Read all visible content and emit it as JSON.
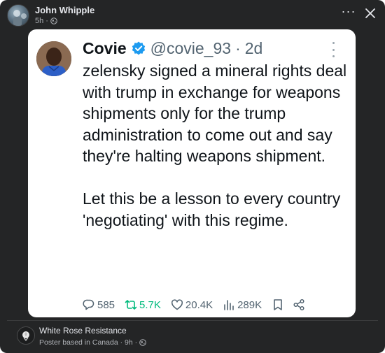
{
  "post": {
    "author": "John Whipple",
    "time": "5h",
    "meta_separator": "·",
    "more_label": "···"
  },
  "tweet": {
    "display_name": "Covie",
    "handle": "@covie_93",
    "separator": "·",
    "time": "2d",
    "text": "zelensky signed a mineral rights deal with trump in exchange for weapons shipments only for the trump administration to come out and say they're halting weapons shipment.\n\nLet this be a lesson to every country 'negotiating' with this regime.",
    "stats": {
      "replies": "585",
      "retweets": "5.7K",
      "likes": "20.4K",
      "views": "289K"
    }
  },
  "footer": {
    "group_name": "White Rose Resistance",
    "meta": "Poster based in Canada · 9h ·"
  },
  "icons": {
    "privacy": "globe-icon",
    "verified": "verified-badge-icon",
    "reply": "reply-icon",
    "retweet": "retweet-icon",
    "like": "heart-icon",
    "views": "views-icon",
    "bookmark": "bookmark-icon",
    "share": "share-icon",
    "close": "close-icon"
  },
  "colors": {
    "background": "#242526",
    "card": "#ffffff",
    "verified": "#1d9bf0",
    "retweet": "#00ba7c",
    "muted": "#536471"
  }
}
